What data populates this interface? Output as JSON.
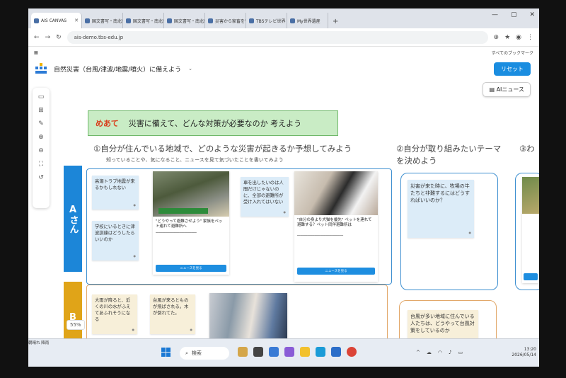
{
  "browser": {
    "tabs": [
      {
        "label": "AIS CANVAS"
      },
      {
        "label": "国文書写・南北朝"
      },
      {
        "label": "国文書写・南北朝"
      },
      {
        "label": "国文書写・南北朝"
      },
      {
        "label": "災害から家畜を守る"
      },
      {
        "label": "TBSテレビ世界"
      },
      {
        "label": "My世界遺産"
      }
    ],
    "new_tab": "+",
    "url": "ais-demo.tbs-edu.jp",
    "bookmarks_label": "すべてのブックマーク"
  },
  "app": {
    "title": "自然災害（台風/津波/地震/噴火）に備えよう",
    "reset_label": "リセット",
    "ainews_label": "AIニュース",
    "zoom": "55%"
  },
  "canvas": {
    "goal_label": "めあて",
    "goal_text": "災害に備えて、どんな対策が必要なのか 考えよう",
    "heading1": "①自分が住んでいる地域で、どのような災害が起きるか予想してみよう",
    "heading1_sub": "知っていることや、気になること、ニュースを見て気づいたことを書いてみよう",
    "heading2": "②自分が取り組みたいテーマを決めよう",
    "heading3": "③わ",
    "rowA": "Aさん",
    "rowB": "B",
    "stickies_A": [
      {
        "text": "高潮トラブ地震が来るかもしれない"
      },
      {
        "text": "学校にいるときに津波訓練はどうしたらいいのか"
      },
      {
        "text": "車を出したいのは人間だけじゃないのに、全部の避難所が受け入れてはいない"
      }
    ],
    "cards_A": [
      {
        "caption": "\"どうやって避難させよう\" 家族をペット連れて避難所へ",
        "button": "ニュースを見る"
      },
      {
        "caption": "\"自分の身より犬猫を優先\" ペットを連れて避難する？ペット同伴避難所は",
        "button": "ニュースを見る"
      }
    ],
    "sticky_A2": {
      "text": "災害が来た時に、牧場の牛たちと非難するにはどうすればいいのか？"
    },
    "stickies_B": [
      {
        "text": "大雨が降ると、近くの川の水がふえてあふれそうになる"
      },
      {
        "text": "台風が来るとものが飛ばされる。木が倒れてた。"
      }
    ],
    "sticky_B2": {
      "text": "台風が多い地域に住んでいる人たちは、どうやって台風対策をしているのか"
    }
  },
  "taskbar": {
    "weather": "朝晴れ 降雨",
    "search_placeholder": "検索",
    "time": "13:20",
    "date": "2026/05/14"
  }
}
